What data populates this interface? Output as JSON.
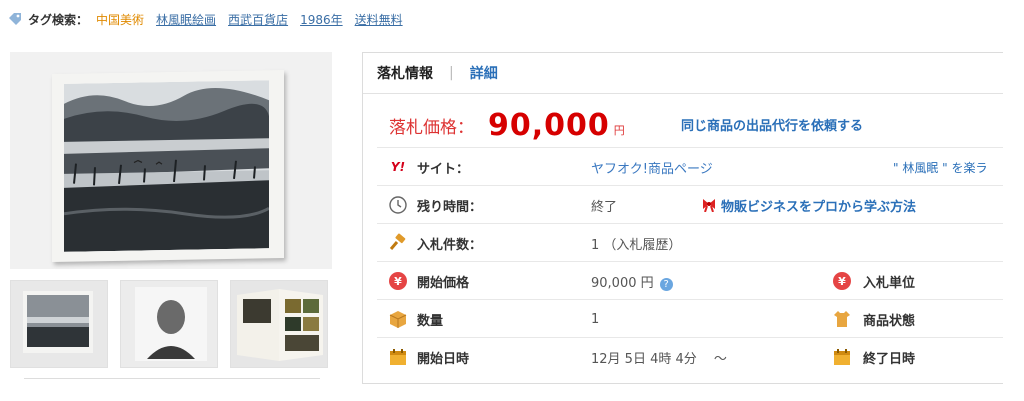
{
  "tags": {
    "label": "タグ検索：",
    "items": [
      {
        "text": "中国美術",
        "style": "orange"
      },
      {
        "text": "林風眠絵画",
        "style": "link"
      },
      {
        "text": "西武百貨店",
        "style": "link"
      },
      {
        "text": "1986年",
        "style": "link"
      },
      {
        "text": "送料無料",
        "style": "link"
      }
    ]
  },
  "panel": {
    "tab_active": "落札情報",
    "tab_separator": "|",
    "tab_link": "詳細",
    "price_label": "落札価格：",
    "price_value": "90,000",
    "price_unit": "円",
    "proxy_link": "同じ商品の出品代行を依頼する",
    "rows": {
      "site": {
        "label": "サイト：",
        "value": "ヤフオク!商品ページ",
        "right": "\" 林風眠 \" を楽ラ"
      },
      "time": {
        "label": "残り時間：",
        "value": "終了",
        "mid_link": "物販ビジネスをプロから学ぶ方法"
      },
      "bids": {
        "label": "入札件数：",
        "value": "1 （入札履歴）"
      },
      "start_price": {
        "label": "開始価格",
        "value": "90,000 円",
        "help": "?",
        "right_label": "入札単位"
      },
      "quantity": {
        "label": "数量",
        "value": "1",
        "right_label": "商品状態"
      },
      "start_date": {
        "label": "開始日時",
        "value": "12月 5日 4時 4分 　～",
        "right_label": "終了日時"
      }
    },
    "yahoo_mark": "Y!",
    "yen_mark": "¥"
  }
}
